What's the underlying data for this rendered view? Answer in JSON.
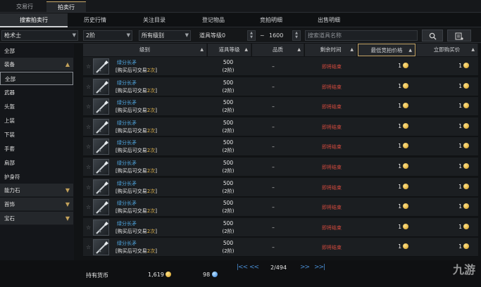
{
  "top_tabs": [
    "交易行",
    "拍卖行"
  ],
  "sub_tabs": [
    "搜索拍卖行",
    "历史行情",
    "关注目录",
    "登记物品",
    "竞拍明细",
    "出售明细"
  ],
  "filters": {
    "class": "枪术士",
    "tier": "2阶",
    "grade": "所有级别",
    "item_level_label": "道具等级",
    "level_min": "0",
    "range_sep": "~",
    "level_max": "1600",
    "search_placeholder": "搜索道具名称"
  },
  "sidebar": [
    {
      "label": "全部",
      "type": "item"
    },
    {
      "label": "装备",
      "type": "cat",
      "expanded": true
    },
    {
      "label": "全部",
      "type": "item",
      "selected": true
    },
    {
      "label": "武器",
      "type": "item"
    },
    {
      "label": "头盔",
      "type": "item"
    },
    {
      "label": "上装",
      "type": "item"
    },
    {
      "label": "下装",
      "type": "item"
    },
    {
      "label": "手套",
      "type": "item"
    },
    {
      "label": "肩部",
      "type": "item"
    },
    {
      "label": "护身符",
      "type": "item"
    },
    {
      "label": "能力石",
      "type": "cat"
    },
    {
      "label": "首饰",
      "type": "cat"
    },
    {
      "label": "宝石",
      "type": "cat"
    }
  ],
  "table": {
    "columns": [
      "级别",
      "道具等级",
      "品质",
      "剩余时间",
      "最低竞拍价格",
      "立即购买价"
    ],
    "rows": [
      {
        "name": "绿分长矛",
        "cond_pre": "[购买后可交易",
        "cond_num": "2次",
        "cond_post": "]",
        "level": "500",
        "tier": "(2阶)",
        "quality": "–",
        "time": "即将结束",
        "bid": "1",
        "buy": "1"
      },
      {
        "name": "绿分长矛",
        "cond_pre": "[购买后可交易",
        "cond_num": "2次",
        "cond_post": "]",
        "level": "500",
        "tier": "(2阶)",
        "quality": "–",
        "time": "即将结束",
        "bid": "1",
        "buy": "1"
      },
      {
        "name": "绿分长矛",
        "cond_pre": "[购买后可交易",
        "cond_num": "2次",
        "cond_post": "]",
        "level": "500",
        "tier": "(2阶)",
        "quality": "–",
        "time": "即将结束",
        "bid": "1",
        "buy": "1"
      },
      {
        "name": "绿分长矛",
        "cond_pre": "[购买后可交易",
        "cond_num": "2次",
        "cond_post": "]",
        "level": "500",
        "tier": "(2阶)",
        "quality": "–",
        "time": "即将结束",
        "bid": "1",
        "buy": "1"
      },
      {
        "name": "绿分长矛",
        "cond_pre": "[购买后可交易",
        "cond_num": "2次",
        "cond_post": "]",
        "level": "500",
        "tier": "(2阶)",
        "quality": "–",
        "time": "即将结束",
        "bid": "1",
        "buy": "1"
      },
      {
        "name": "绿分长矛",
        "cond_pre": "[购买后可交易",
        "cond_num": "2次",
        "cond_post": "]",
        "level": "500",
        "tier": "(2阶)",
        "quality": "–",
        "time": "即将结束",
        "bid": "1",
        "buy": "1"
      },
      {
        "name": "绿分长矛",
        "cond_pre": "[购买后可交易",
        "cond_num": "2次",
        "cond_post": "]",
        "level": "500",
        "tier": "(2阶)",
        "quality": "–",
        "time": "即将结束",
        "bid": "1",
        "buy": "1"
      },
      {
        "name": "绿分长矛",
        "cond_pre": "[购买后可交易",
        "cond_num": "2次",
        "cond_post": "]",
        "level": "500",
        "tier": "(2阶)",
        "quality": "–",
        "time": "即将结束",
        "bid": "1",
        "buy": "1"
      },
      {
        "name": "绿分长矛",
        "cond_pre": "[购买后可交易",
        "cond_num": "2次",
        "cond_post": "]",
        "level": "500",
        "tier": "(2阶)",
        "quality": "–",
        "time": "即将结束",
        "bid": "1",
        "buy": "1"
      },
      {
        "name": "绿分长矛",
        "cond_pre": "[购买后可交易",
        "cond_num": "2次",
        "cond_post": "]",
        "level": "500",
        "tier": "(2阶)",
        "quality": "–",
        "time": "即将结束",
        "bid": "1",
        "buy": "1"
      }
    ]
  },
  "footer": {
    "currency_label": "持有货币",
    "gold": "1,619",
    "crystal": "98",
    "page": "2/494",
    "first": "|<<",
    "prev": "<<",
    "next": ">>",
    "last": ">>|"
  },
  "watermark": "九游",
  "colors": {
    "accent_gold": "#c8a86a",
    "item_name": "#4fa6e0",
    "time_red": "#d2493d"
  }
}
